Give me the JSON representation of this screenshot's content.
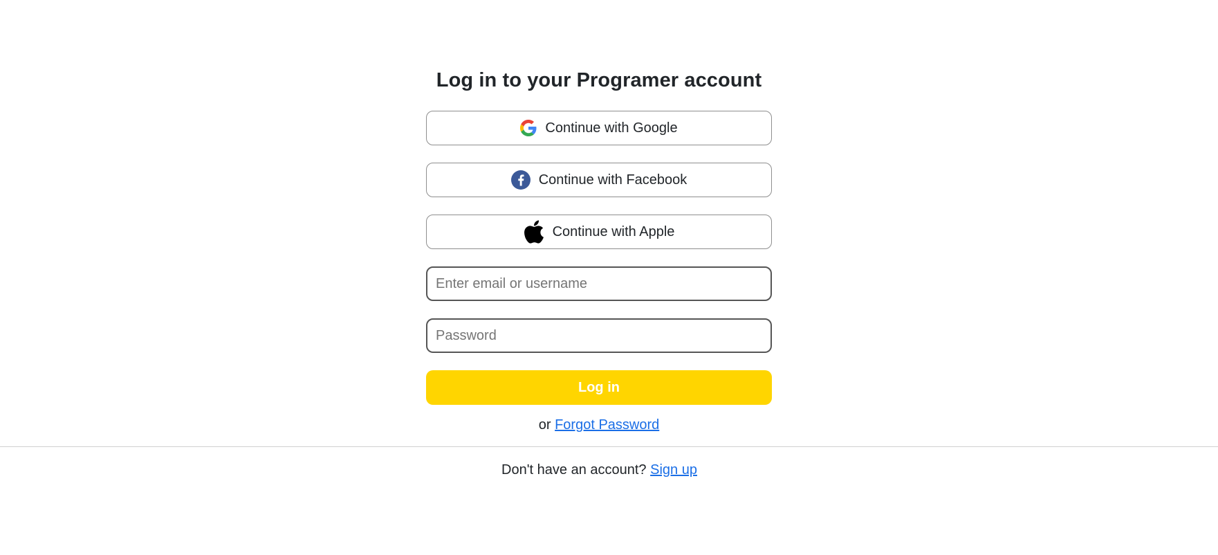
{
  "login": {
    "title": "Log in to your Programer account",
    "social": {
      "google_label": "Continue with Google",
      "facebook_label": "Continue with Facebook",
      "apple_label": "Continue with Apple"
    },
    "email_placeholder": "Enter email or username",
    "password_placeholder": "Password",
    "login_button_label": "Log in",
    "forgot_prefix": "or",
    "forgot_link": "Forgot Password"
  },
  "signup": {
    "prompt": "Don't have an account?",
    "link": "Sign up"
  },
  "icons": {
    "google": "google-icon",
    "facebook": "facebook-icon",
    "apple": "apple-icon"
  },
  "colors": {
    "accent": "#ffd500",
    "link": "#1a6ee6",
    "facebook": "#3b5998"
  }
}
